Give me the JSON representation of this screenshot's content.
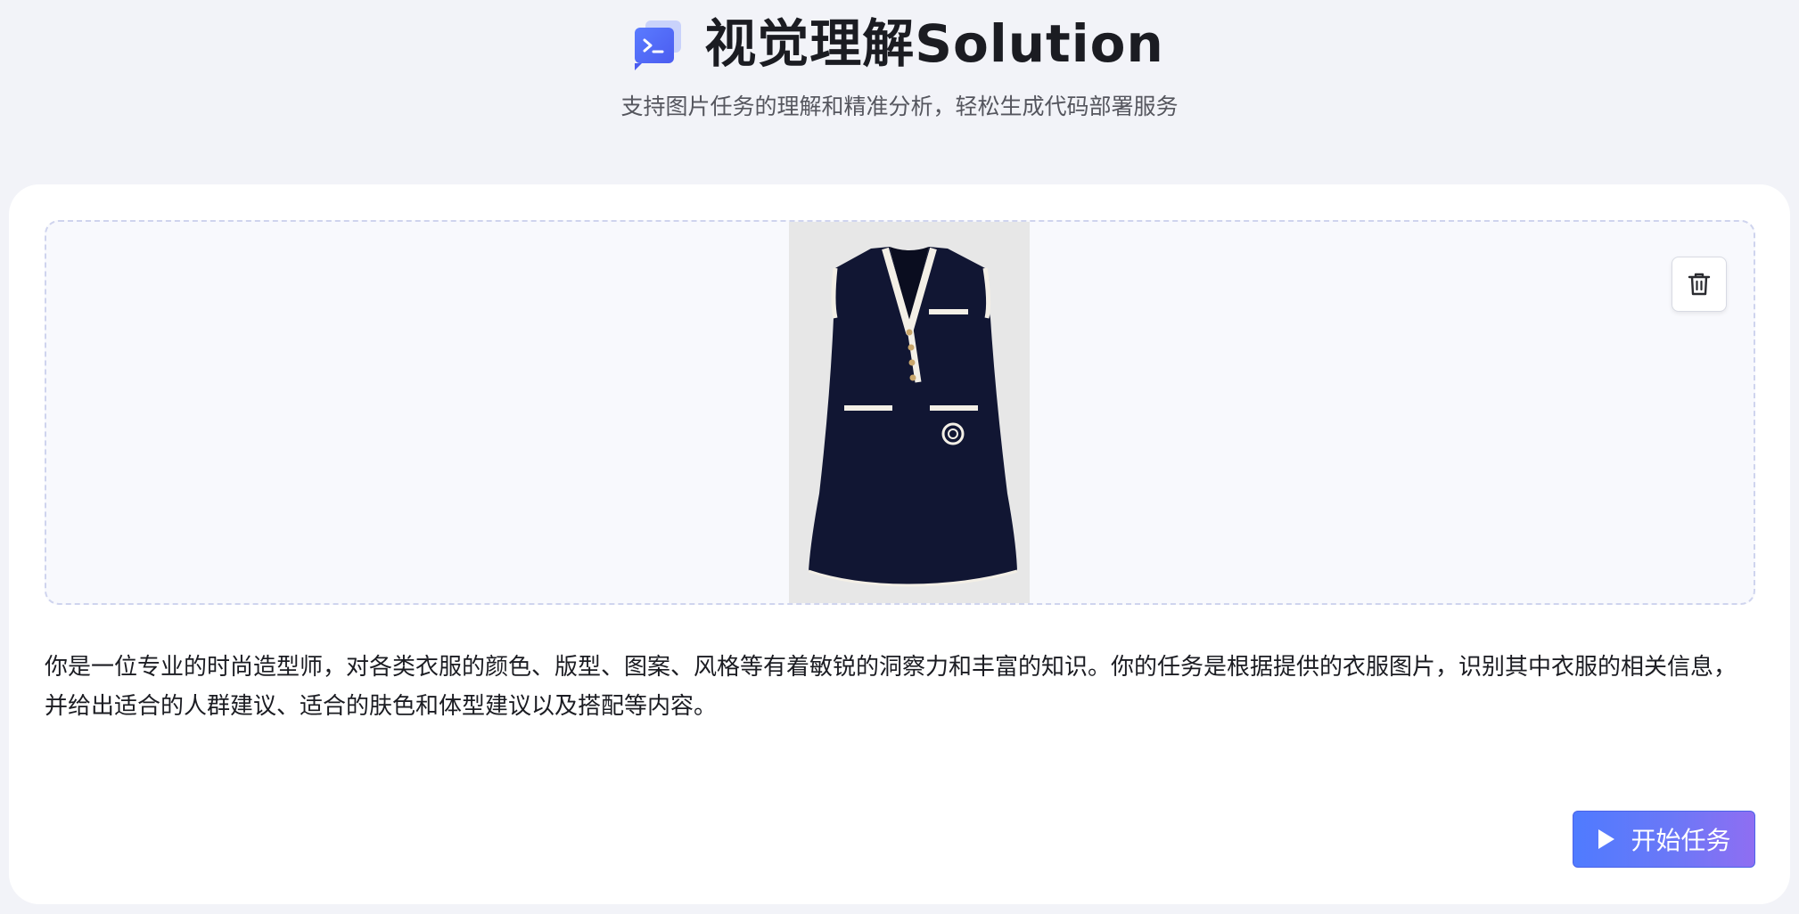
{
  "header": {
    "title": "视觉理解Solution",
    "subtitle": "支持图片任务的理解和精准分析，轻松生成代码部署服务",
    "logo_icon": "terminal-chat-icon"
  },
  "upload": {
    "image_description_icon": "uploaded-image",
    "delete_icon": "trash-icon"
  },
  "prompt": {
    "text": "你是一位专业的时尚造型师，对各类衣服的颜色、版型、图案、风格等有着敏锐的洞察力和丰富的知识。你的任务是根据提供的衣服图片，识别其中衣服的相关信息，并给出适合的人群建议、适合的肤色和体型建议以及搭配等内容。"
  },
  "actions": {
    "start_label": "开始任务",
    "start_icon": "play-icon"
  },
  "colors": {
    "background": "#f2f3f8",
    "accent": "#4f7bff",
    "accent_end": "#8f6ef2",
    "dress": "#111633",
    "trim": "#f3efe6"
  }
}
